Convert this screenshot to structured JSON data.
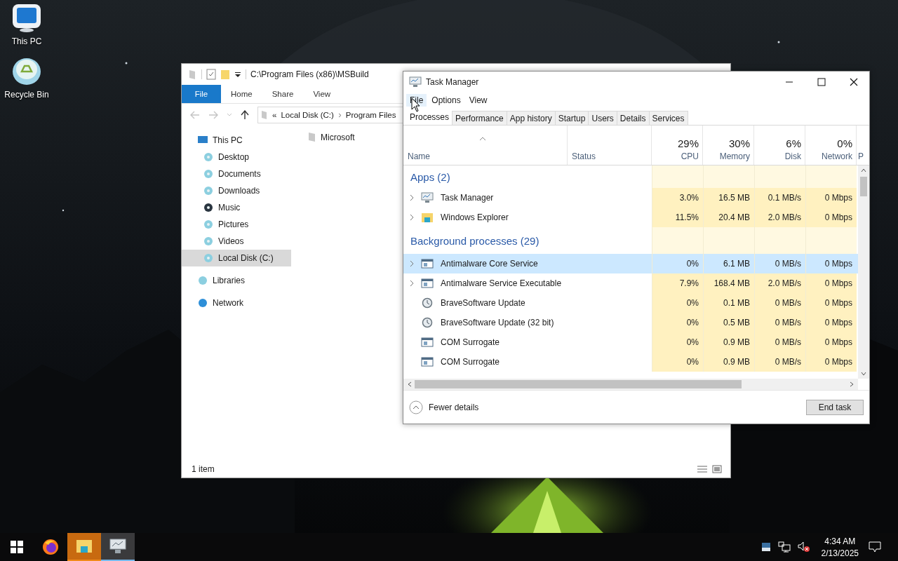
{
  "desktop": {
    "icons": [
      {
        "label": "This PC",
        "kind": "pc"
      },
      {
        "label": "Recycle Bin",
        "kind": "recycle"
      }
    ]
  },
  "explorer": {
    "path": "C:\\Program Files (x86)\\MSBuild",
    "ribbon_tabs": [
      {
        "label": "File",
        "kind": "menu"
      },
      {
        "label": "Home",
        "kind": "tab"
      },
      {
        "label": "Share",
        "kind": "tab"
      },
      {
        "label": "View",
        "kind": "tab"
      }
    ],
    "breadcrumb_overflow": "«",
    "breadcrumb": [
      "Local Disk (C:)",
      "Program Files"
    ],
    "nav": [
      {
        "label": "This PC",
        "kind": "pc",
        "selected": false,
        "children": [
          {
            "label": "Desktop",
            "kind": "disc",
            "selected": false
          },
          {
            "label": "Documents",
            "kind": "disc",
            "selected": false
          },
          {
            "label": "Downloads",
            "kind": "disc",
            "selected": false
          },
          {
            "label": "Music",
            "kind": "dark",
            "selected": false
          },
          {
            "label": "Pictures",
            "kind": "disc",
            "selected": false
          },
          {
            "label": "Videos",
            "kind": "disc",
            "selected": false
          },
          {
            "label": "Local Disk (C:)",
            "kind": "disc",
            "selected": true
          }
        ]
      },
      {
        "label": "Libraries",
        "kind": "disc",
        "selected": false
      },
      {
        "label": "Network",
        "kind": "globe",
        "selected": false
      }
    ],
    "items": [
      {
        "label": "Microsoft"
      }
    ],
    "status": "1 item"
  },
  "task_manager": {
    "title": "Task Manager",
    "menu": [
      {
        "label": "File",
        "hovered": true
      },
      {
        "label": "Options",
        "hovered": false
      },
      {
        "label": "View",
        "hovered": false
      }
    ],
    "tabs": [
      {
        "label": "Processes",
        "selected": true
      },
      {
        "label": "Performance",
        "selected": false
      },
      {
        "label": "App history",
        "selected": false
      },
      {
        "label": "Startup",
        "selected": false
      },
      {
        "label": "Users",
        "selected": false
      },
      {
        "label": "Details",
        "selected": false
      },
      {
        "label": "Services",
        "selected": false
      }
    ],
    "columns": [
      {
        "label": "Name"
      },
      {
        "label": "Status"
      },
      {
        "label": "CPU",
        "usage": "29%"
      },
      {
        "label": "Memory",
        "usage": "30%"
      },
      {
        "label": "Disk",
        "usage": "6%"
      },
      {
        "label": "Network",
        "usage": "0%"
      },
      {
        "label": "P"
      }
    ],
    "groups": [
      {
        "title": "Apps (2)",
        "rows": [
          {
            "name": "Task Manager",
            "kind": "monitor",
            "expandable": true,
            "selected": false,
            "cpu": "3.0%",
            "memory": "16.5 MB",
            "disk": "0.1 MB/s",
            "network": "0 Mbps"
          },
          {
            "name": "Windows Explorer",
            "kind": "folder",
            "expandable": true,
            "selected": false,
            "cpu": "11.5%",
            "memory": "20.4 MB",
            "disk": "2.0 MB/s",
            "network": "0 Mbps"
          }
        ]
      },
      {
        "title": "Background processes (29)",
        "rows": [
          {
            "name": "Antimalware Core Service",
            "kind": "service",
            "expandable": true,
            "selected": true,
            "cpu": "0%",
            "memory": "6.1 MB",
            "disk": "0 MB/s",
            "network": "0 Mbps"
          },
          {
            "name": "Antimalware Service Executable",
            "kind": "service",
            "expandable": true,
            "selected": false,
            "cpu": "7.9%",
            "memory": "168.4 MB",
            "disk": "2.0 MB/s",
            "network": "0 Mbps"
          },
          {
            "name": "BraveSoftware Update",
            "kind": "updater",
            "expandable": false,
            "selected": false,
            "cpu": "0%",
            "memory": "0.1 MB",
            "disk": "0 MB/s",
            "network": "0 Mbps"
          },
          {
            "name": "BraveSoftware Update (32 bit)",
            "kind": "updater",
            "expandable": false,
            "selected": false,
            "cpu": "0%",
            "memory": "0.5 MB",
            "disk": "0 MB/s",
            "network": "0 Mbps"
          },
          {
            "name": "COM Surrogate",
            "kind": "service",
            "expandable": false,
            "selected": false,
            "cpu": "0%",
            "memory": "0.9 MB",
            "disk": "0 MB/s",
            "network": "0 Mbps"
          },
          {
            "name": "COM Surrogate",
            "kind": "service",
            "expandable": false,
            "selected": false,
            "cpu": "0%",
            "memory": "0.9 MB",
            "disk": "0 MB/s",
            "network": "0 Mbps"
          }
        ]
      }
    ],
    "fewer_details": "Fewer details",
    "end_task": "End task"
  },
  "taskbar": {
    "apps": [
      {
        "kind": "windows",
        "flashing": false,
        "selected": false
      },
      {
        "kind": "firefox",
        "flashing": false,
        "selected": false
      },
      {
        "kind": "explorer",
        "flashing": true,
        "selected": false
      },
      {
        "kind": "taskmgr",
        "flashing": false,
        "selected": true
      }
    ],
    "tray": [
      {
        "kind": "defender"
      },
      {
        "kind": "network"
      },
      {
        "kind": "muted"
      }
    ],
    "time": "4:34 AM",
    "date": "2/13/2025"
  }
}
